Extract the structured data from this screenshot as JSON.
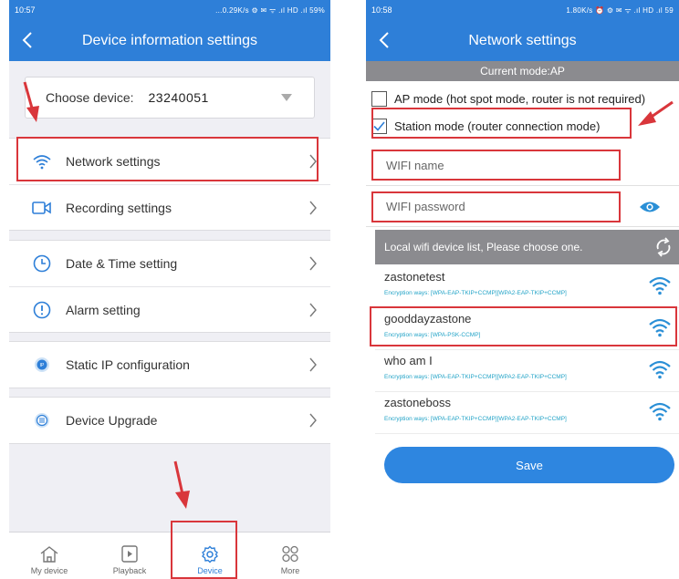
{
  "left": {
    "status": {
      "time": "10:57",
      "indicators": "...0.29K/s ⚙ ✉ ᯤ .ıl HD .ıl 59%"
    },
    "title": "Device information settings",
    "device": {
      "label": "Choose device:",
      "value": "23240051"
    },
    "menu": [
      {
        "label": "Network settings",
        "icon": "wifi-icon"
      },
      {
        "label": "Recording settings",
        "icon": "video-icon"
      },
      {
        "label": "Date & Time setting",
        "icon": "clock-icon"
      },
      {
        "label": "Alarm setting",
        "icon": "alert-icon"
      },
      {
        "label": "Static IP configuration",
        "icon": "ip-icon"
      },
      {
        "label": "Device Upgrade",
        "icon": "upgrade-icon"
      }
    ],
    "tabs": [
      {
        "label": "My device",
        "icon": "home-icon"
      },
      {
        "label": "Playback",
        "icon": "play-icon"
      },
      {
        "label": "Device",
        "icon": "gear-icon"
      },
      {
        "label": "More",
        "icon": "grid-icon"
      }
    ]
  },
  "right": {
    "status": {
      "time": "10:58",
      "indicators": "1.80K/s ⏰ ⚙ ✉ ᯤ .ıl HD .ıl 59"
    },
    "title": "Network settings",
    "current_mode": "Current mode:AP",
    "modes": [
      {
        "label": "AP mode (hot spot mode, router is not required)",
        "checked": false
      },
      {
        "label": "Station mode (router connection mode)",
        "checked": true
      }
    ],
    "wifi_name_placeholder": "WIFI name",
    "wifi_password_placeholder": "WIFI password",
    "list_header": "Local wifi device list, Please choose one.",
    "networks": [
      {
        "name": "zastonetest",
        "encryption": "Encryption ways: [WPA-EAP-TKIP+CCMP][WPA2-EAP-TKIP+CCMP]"
      },
      {
        "name": "gooddayzastone",
        "encryption": "Encryption ways: [WPA-PSK-CCMP]"
      },
      {
        "name": "who am I",
        "encryption": "Encryption ways: [WPA-EAP-TKIP+CCMP][WPA2-EAP-TKIP+CCMP]"
      },
      {
        "name": "zastoneboss",
        "encryption": "Encryption ways: [WPA-EAP-TKIP+CCMP][WPA2-EAP-TKIP+CCMP]"
      }
    ],
    "save_label": "Save"
  },
  "colors": {
    "accent": "#2e7fd8",
    "highlight": "#d9363b",
    "wifi": "#2a8fd6",
    "encryption": "#22a3c7"
  }
}
